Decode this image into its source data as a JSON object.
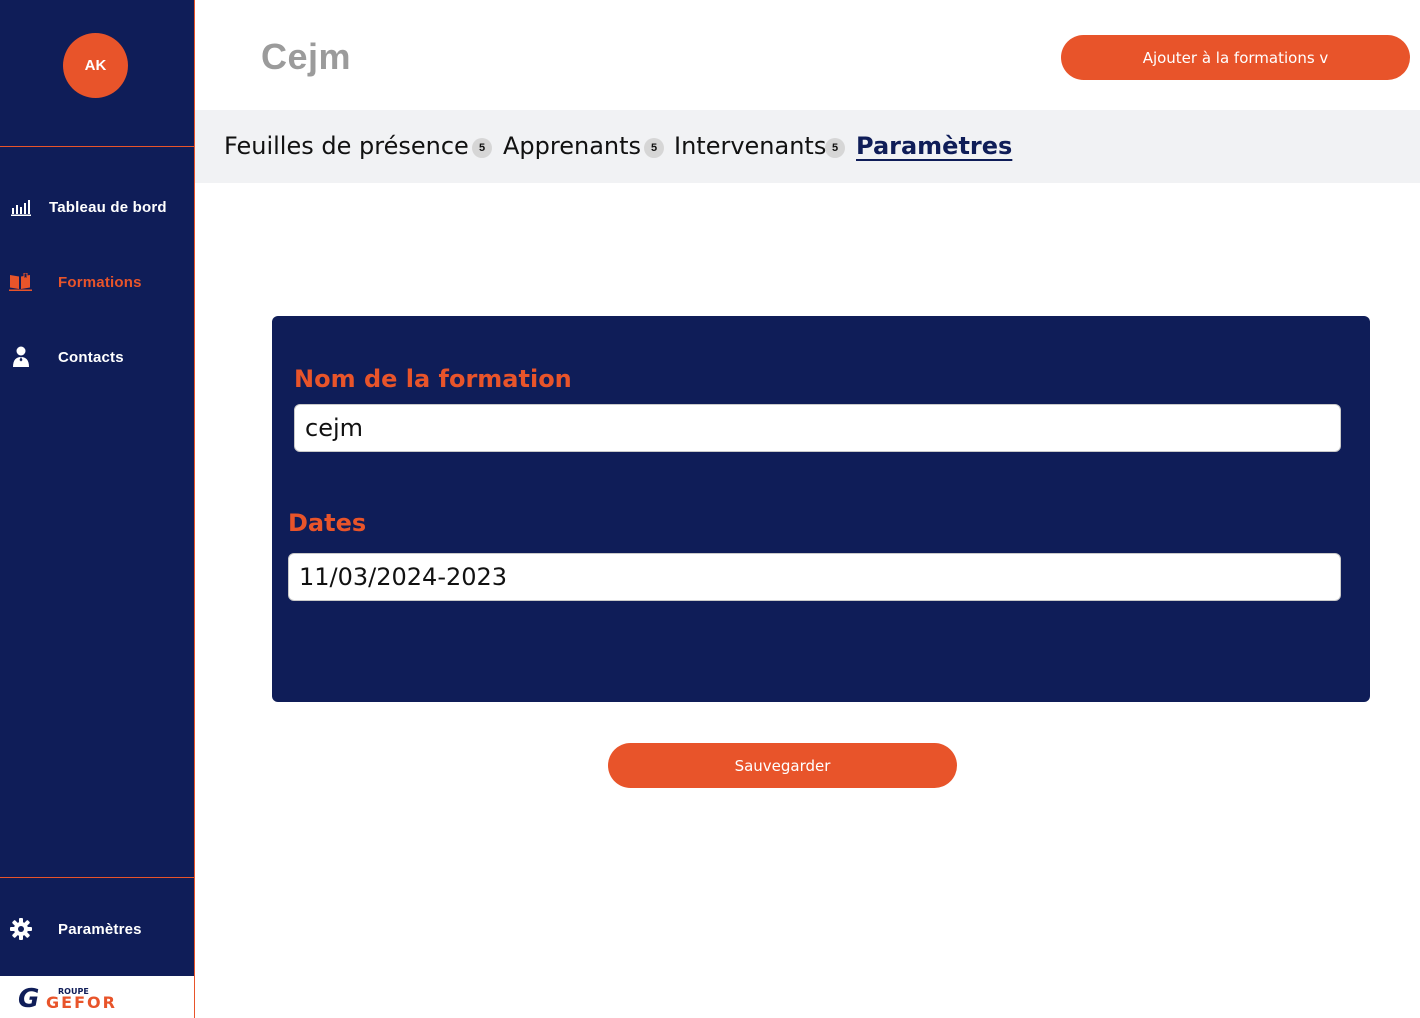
{
  "user": {
    "initials": "AK"
  },
  "sidebar": {
    "items": [
      {
        "label": "Tableau de bord",
        "icon": "bar-chart-icon"
      },
      {
        "label": "Formations",
        "icon": "book-icon",
        "active": true
      },
      {
        "label": "Contacts",
        "icon": "user-icon"
      }
    ],
    "settings": {
      "label": "Paramètres",
      "icon": "gear-icon"
    },
    "logo": {
      "text_small": "ROUPE",
      "text_main": "GEFOR"
    }
  },
  "header": {
    "title": "Cejm",
    "add_button_label": "Ajouter à la formations v"
  },
  "tabs": [
    {
      "label": "Feuilles de présence",
      "count": "5"
    },
    {
      "label": "Apprenants",
      "count": "5"
    },
    {
      "label": "Intervenants",
      "count": "5"
    },
    {
      "label": "Paramètres",
      "active": true
    }
  ],
  "form": {
    "name_label": "Nom de la formation",
    "name_value": "cejm",
    "dates_label": "Dates",
    "dates_value": "11/03/2024-2023",
    "save_label": "Sauvegarder"
  },
  "colors": {
    "navy": "#0f1d58",
    "accent": "#e8542a",
    "title_gray": "#9b9b9b",
    "tabs_bg": "#f1f2f4"
  }
}
